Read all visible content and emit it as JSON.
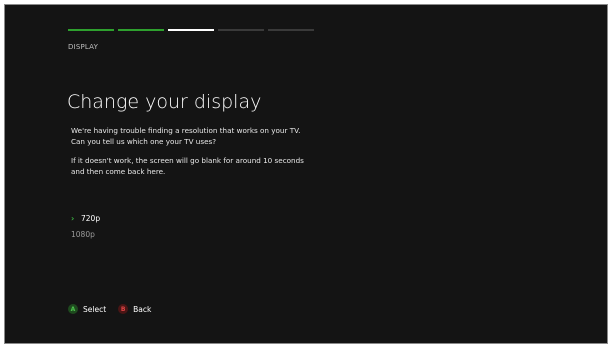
{
  "progress": {
    "segments": [
      "done",
      "done",
      "current",
      "todo",
      "todo"
    ]
  },
  "section": "DISPLAY",
  "title": "Change your display",
  "paragraphs": {
    "p1_line1": "We're having trouble finding a resolution that works on your TV.",
    "p1_line2": "Can you tell us which one your TV uses?",
    "p2_line1": "If it doesn't work, the screen will go blank for around 10 seconds",
    "p2_line2": "and then come back here."
  },
  "options": [
    {
      "label": "720p",
      "selected": true
    },
    {
      "label": "1080p",
      "selected": false
    }
  ],
  "footer": {
    "a_glyph": "A",
    "a_label": "Select",
    "b_glyph": "B",
    "b_label": "Back"
  },
  "colors": {
    "accent_green": "#2ea02e",
    "background": "#141414",
    "button_a": "#4cc14c",
    "button_b": "#e04545"
  },
  "icons": {
    "selection": "chevron-right-icon"
  }
}
